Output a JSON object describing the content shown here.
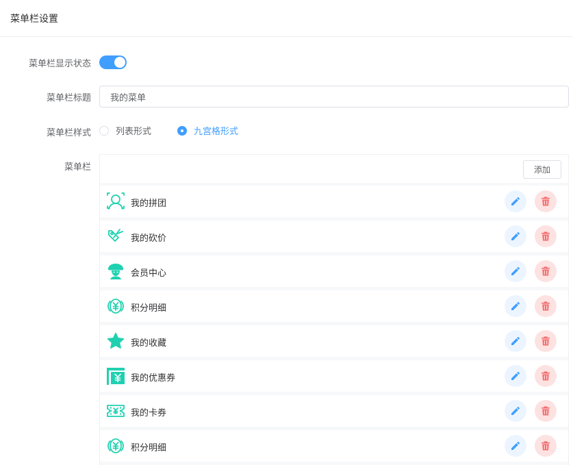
{
  "header": {
    "title": "菜单栏设置"
  },
  "form": {
    "display_label": "菜单栏显示状态",
    "display_on": true,
    "title_label": "菜单栏标题",
    "title_value": "我的菜单",
    "style_label": "菜单栏样式",
    "style_options": [
      "列表形式",
      "九宫格形式"
    ],
    "style_selected": "九宫格形式",
    "menu_label": "菜单栏"
  },
  "menu": {
    "add_label": "添加",
    "items": [
      {
        "label": "我的拼团",
        "icon": "group-icon"
      },
      {
        "label": "我的砍价",
        "icon": "bargain-icon"
      },
      {
        "label": "会员中心",
        "icon": "member-icon"
      },
      {
        "label": "积分明细",
        "icon": "points-icon"
      },
      {
        "label": "我的收藏",
        "icon": "star-icon"
      },
      {
        "label": "我的优惠券",
        "icon": "coupon-icon"
      },
      {
        "label": "我的卡券",
        "icon": "card-ticket-icon"
      },
      {
        "label": "积分明细",
        "icon": "points-icon"
      }
    ]
  },
  "colors": {
    "accent": "#409eff",
    "icon": "#1fd1b0",
    "danger": "#f56c6c"
  }
}
